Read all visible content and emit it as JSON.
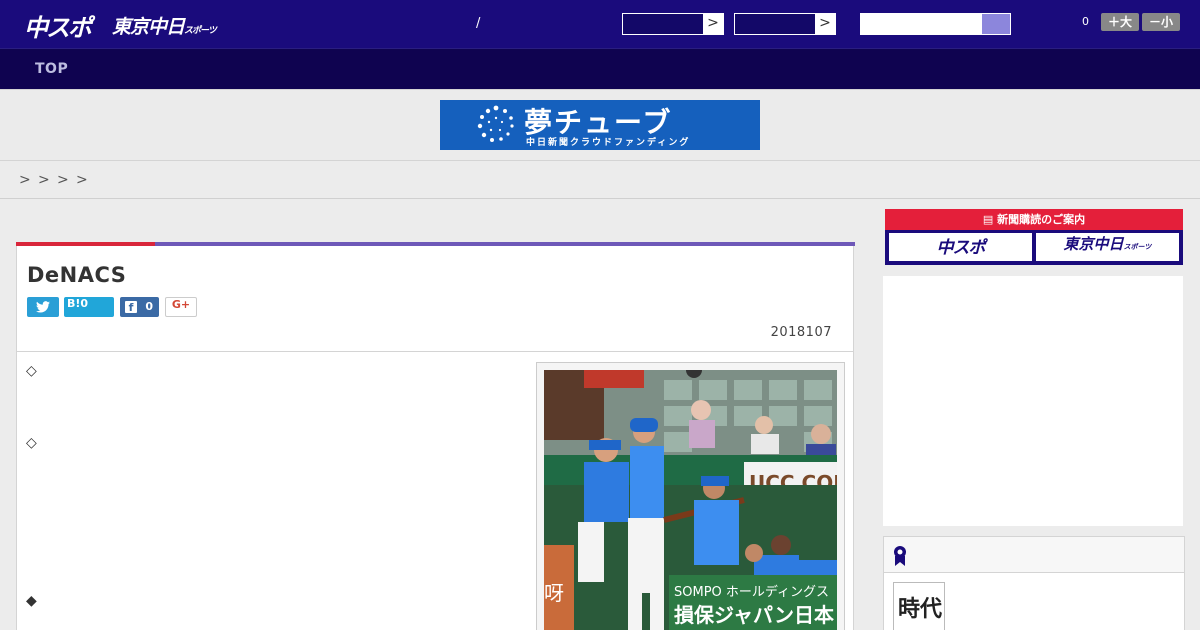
{
  "header": {
    "logo_chuspo": "中スポ",
    "logo_tokyo": "東京中日",
    "logo_tokyo_sub": "スポーツ",
    "slash": "/",
    "select_arrow": ">",
    "font_size_count": "0",
    "font_larger": "＋大",
    "font_smaller": "－小"
  },
  "nav": {
    "top_label": "TOP"
  },
  "banner": {
    "title": "夢チューブ",
    "subtitle": "中日新聞クラウドファンディング"
  },
  "breadcrumb": [
    ">",
    ">",
    ">",
    ">"
  ],
  "article": {
    "title": "DeNACS",
    "share": {
      "twitter_icon": "twitter-bird-icon",
      "hatena_label": "B!",
      "hatena_count": "0",
      "facebook_icon": "f",
      "facebook_count": "0",
      "gplus_label": "G+"
    },
    "date": "2018107",
    "markers": [
      "◇",
      "◇",
      "◆"
    ]
  },
  "photo": {
    "wall_banner": "UCC COFFEE",
    "sponsor_top": "SOMPO ホールディングス",
    "sponsor_bottom": "損保ジャパン日本"
  },
  "sidebar": {
    "subscription_header": "新聞購読のご案内",
    "subscription_chuspo": "中スポ",
    "subscription_tokyo": "東京中日",
    "subscription_tokyo_sub": "スポーツ",
    "ranking_thumb_text": "時代"
  },
  "colors": {
    "header_bg": "#1a0b7c",
    "nav_bg": "#0f0350",
    "accent_red": "#d9263b",
    "accent_purple": "#6e58b8",
    "banner_blue": "#1560bd"
  }
}
